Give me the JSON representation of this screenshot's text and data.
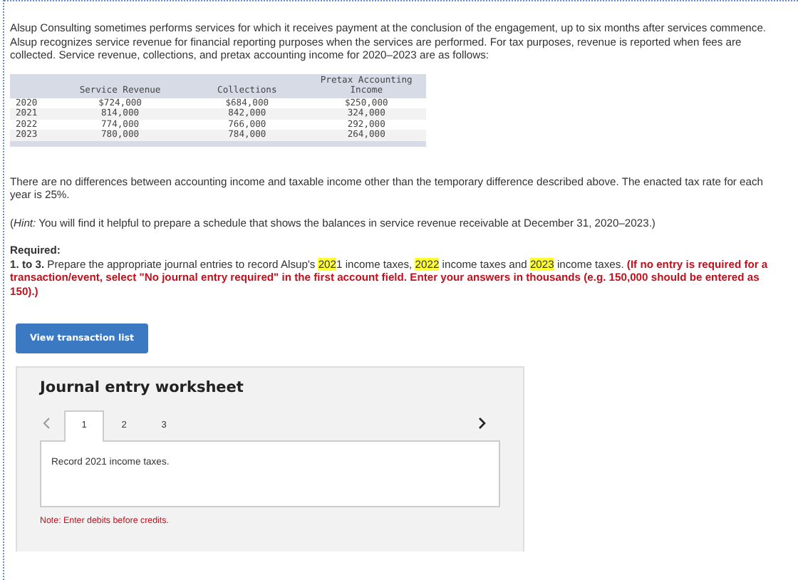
{
  "intro": "Alsup Consulting sometimes performs services for which it receives payment at the conclusion of the engagement, up to six months after services commence. Alsup recognizes service revenue for financial reporting purposes when the services are performed. For tax purposes, revenue is reported when fees are collected. Service revenue, collections, and pretax accounting income for 2020–2023 are as follows:",
  "table": {
    "columns": [
      "",
      "Service Revenue",
      "Collections",
      "Pretax Accounting Income"
    ],
    "rows": [
      [
        "2020",
        "$724,000",
        "$684,000",
        "$250,000"
      ],
      [
        "2021",
        "814,000",
        "842,000",
        "324,000"
      ],
      [
        "2022",
        "774,000",
        "766,000",
        "292,000"
      ],
      [
        "2023",
        "780,000",
        "784,000",
        "264,000"
      ]
    ]
  },
  "note": "There are no differences between accounting income and taxable income other than the temporary difference described above. The enacted tax rate for each year is 25%.",
  "hint": "(*Hint:* You will find it helpful to prepare a schedule that shows the balances in service revenue receivable at December 31, 2020–2023.)",
  "required": {
    "heading": "Required:",
    "number": "1. to 3.",
    "segments": [
      {
        "text": " Prepare the appropriate journal entries to record Alsup's ",
        "highlighted": false
      },
      {
        "text": "202",
        "highlighted": true
      },
      {
        "text": "1 income taxes, ",
        "highlighted": false
      },
      {
        "text": "2022",
        "highlighted": true
      },
      {
        "text": " income taxes and ",
        "highlighted": false
      },
      {
        "text": "2023",
        "highlighted": true
      },
      {
        "text": " income taxes. ",
        "highlighted": false
      }
    ],
    "instruction": "(If no entry is required for a transaction/event, select \"No journal entry required\" in the first account field. Enter your answers in thousands (e.g. 150,000 should be entered as 150).)"
  },
  "button": "View transaction list",
  "worksheet": {
    "title": "Journal entry worksheet",
    "tabs": [
      {
        "label": "1",
        "selected": true
      },
      {
        "label": "2",
        "selected": false
      },
      {
        "label": "3",
        "selected": false
      }
    ],
    "prompt": "Record 2021 income taxes.",
    "note": "Note: Enter debits before credits."
  }
}
